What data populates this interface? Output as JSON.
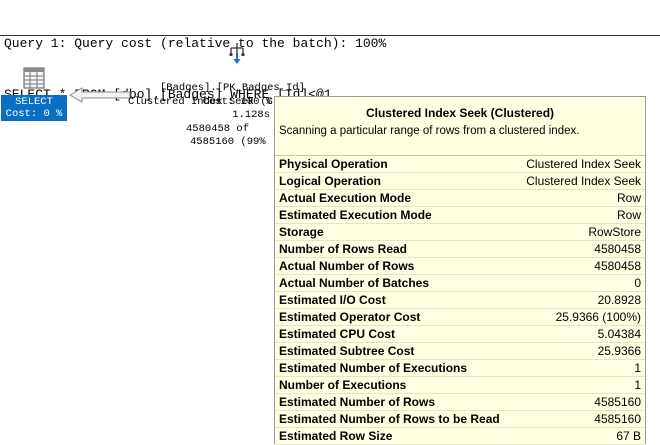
{
  "query": {
    "line1": "Query 1: Query cost (relative to the batch): 100%",
    "line2": "SELECT * FROM [dbo].[Badges] WHERE [Id]<@1"
  },
  "select_node": {
    "label": "SELECT",
    "cost": "Cost: 0 %"
  },
  "seek_node": {
    "line1": "Clustered Index Seek (Clustered)",
    "line2": "[Badges].[PK_Badges_Id]",
    "line3": "Cost: 100 %",
    "line4": "1.128s",
    "line5": "4580458 of",
    "line6": "4585160 (99%"
  },
  "tooltip": {
    "title": "Clustered Index Seek (Clustered)",
    "description": "Scanning a particular range of rows from a clustered index.",
    "rows": [
      {
        "label": "Physical Operation",
        "value": "Clustered Index Seek"
      },
      {
        "label": "Logical Operation",
        "value": "Clustered Index Seek"
      },
      {
        "label": "Actual Execution Mode",
        "value": "Row"
      },
      {
        "label": "Estimated Execution Mode",
        "value": "Row"
      },
      {
        "label": "Storage",
        "value": "RowStore"
      },
      {
        "label": "Number of Rows Read",
        "value": "4580458"
      },
      {
        "label": "Actual Number of Rows",
        "value": "4580458"
      },
      {
        "label": "Actual Number of Batches",
        "value": "0"
      },
      {
        "label": "Estimated I/O Cost",
        "value": "20.8928"
      },
      {
        "label": "Estimated Operator Cost",
        "value": "25.9366 (100%)"
      },
      {
        "label": "Estimated CPU Cost",
        "value": "5.04384"
      },
      {
        "label": "Estimated Subtree Cost",
        "value": "25.9366"
      },
      {
        "label": "Estimated Number of Executions",
        "value": "1"
      },
      {
        "label": "Number of Executions",
        "value": "1"
      },
      {
        "label": "Estimated Number of Rows",
        "value": "4585160"
      },
      {
        "label": "Estimated Number of Rows to be Read",
        "value": "4585160"
      },
      {
        "label": "Estimated Row Size",
        "value": "67 B"
      }
    ]
  },
  "colors": {
    "select_bg": "#0a6fc2",
    "tooltip_bg": "#ffffe1"
  }
}
